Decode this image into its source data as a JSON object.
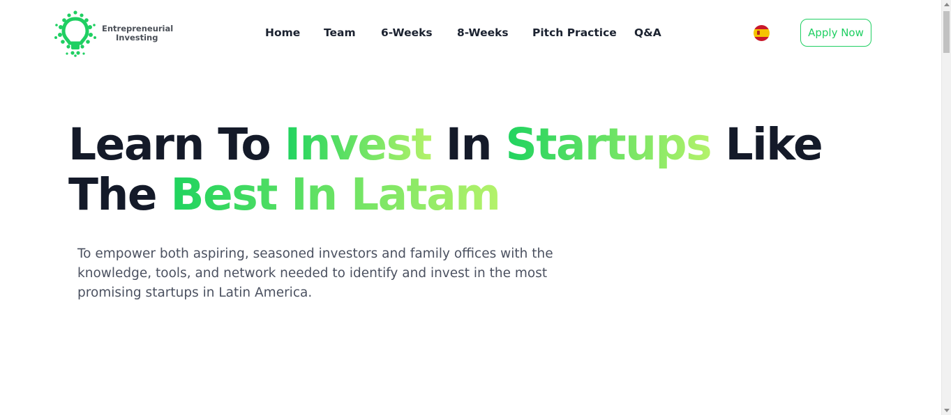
{
  "logo": {
    "line1": "Entrepreneurial",
    "line2": "Investing",
    "icon": "lightbulb-dots-logo",
    "color": "#1fcf62"
  },
  "nav": {
    "items": [
      {
        "label": "Home"
      },
      {
        "label": "Team"
      },
      {
        "label": "6-Weeks"
      },
      {
        "label": "8-Weeks"
      },
      {
        "label": "Pitch Practice"
      },
      {
        "label": "Q&A"
      }
    ]
  },
  "language": {
    "icon": "spain-flag-icon"
  },
  "cta": {
    "apply_label": "Apply Now",
    "color": "#1fcf62"
  },
  "hero": {
    "title": {
      "w1": "Learn To",
      "w2": "Invest",
      "w3": "In",
      "w4": "Startups",
      "w5": "Like",
      "w6": "The",
      "w7": "Best In Latam"
    },
    "subtitle": "To empower both aspiring, seasoned investors and family offices with the knowledge, tools, and network needed to identify and invest in the most promising startups in Latin America.",
    "colors": {
      "dark": "#141a29",
      "gradient_start": "#1fd35f",
      "gradient_end": "#b4f26a"
    }
  }
}
